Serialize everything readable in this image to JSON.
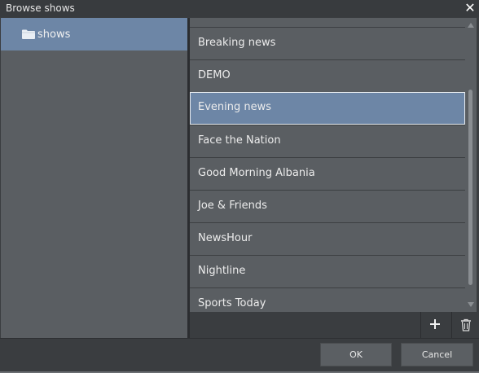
{
  "window": {
    "title": "Browse shows",
    "close_glyph": "✕"
  },
  "tree": {
    "items": [
      {
        "label": "shows",
        "icon": "folder-icon",
        "selected": true
      }
    ]
  },
  "list": {
    "items": [
      {
        "label": "Breaking news"
      },
      {
        "label": "DEMO"
      },
      {
        "label": "Evening news",
        "selected": true
      },
      {
        "label": "Face the Nation"
      },
      {
        "label": "Good Morning Albania"
      },
      {
        "label": "Joe & Friends"
      },
      {
        "label": "NewsHour"
      },
      {
        "label": "Nightline"
      },
      {
        "label": "Sports Today"
      }
    ]
  },
  "toolbar": {
    "add_icon": "plus-icon",
    "delete_icon": "trash-icon"
  },
  "footer": {
    "ok_label": "OK",
    "cancel_label": "Cancel"
  },
  "colors": {
    "selection": "#6d86a6",
    "panel": "#5a5e62",
    "chrome": "#3a3d40"
  }
}
